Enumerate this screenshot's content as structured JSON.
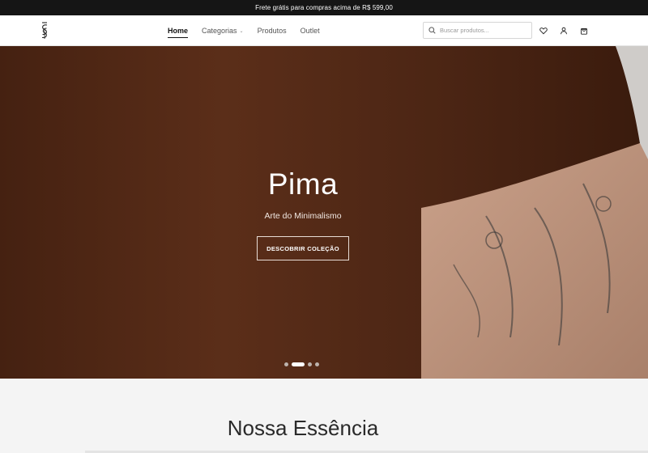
{
  "announcement": {
    "text": "Frete grátis para compras acima de R$ 599,00"
  },
  "header": {
    "logo_icon": "brand-monogram-icon",
    "nav": [
      {
        "label": "Home",
        "active": true
      },
      {
        "label": "Categorias",
        "has_dropdown": true,
        "dropdown_icon": "chevron-down-icon"
      },
      {
        "label": "Produtos"
      },
      {
        "label": "Outlet"
      }
    ],
    "search": {
      "placeholder": "Buscar produtos...",
      "value": "",
      "icon": "search-icon"
    },
    "icons": [
      "heart-icon",
      "user-icon",
      "shopping-bag-icon"
    ]
  },
  "hero": {
    "title": "Pima",
    "subtitle": "Arte do Minimalismo",
    "cta_label": "DESCOBRIR COLEÇÃO",
    "slides_count": 4,
    "active_slide": 2
  },
  "section": {
    "title": "Nossa Essência"
  },
  "colors": {
    "announcement_bg": "#151515",
    "hero_brown": "#4e2615",
    "text_dark": "#111111",
    "page_bg": "#f4f4f4"
  }
}
